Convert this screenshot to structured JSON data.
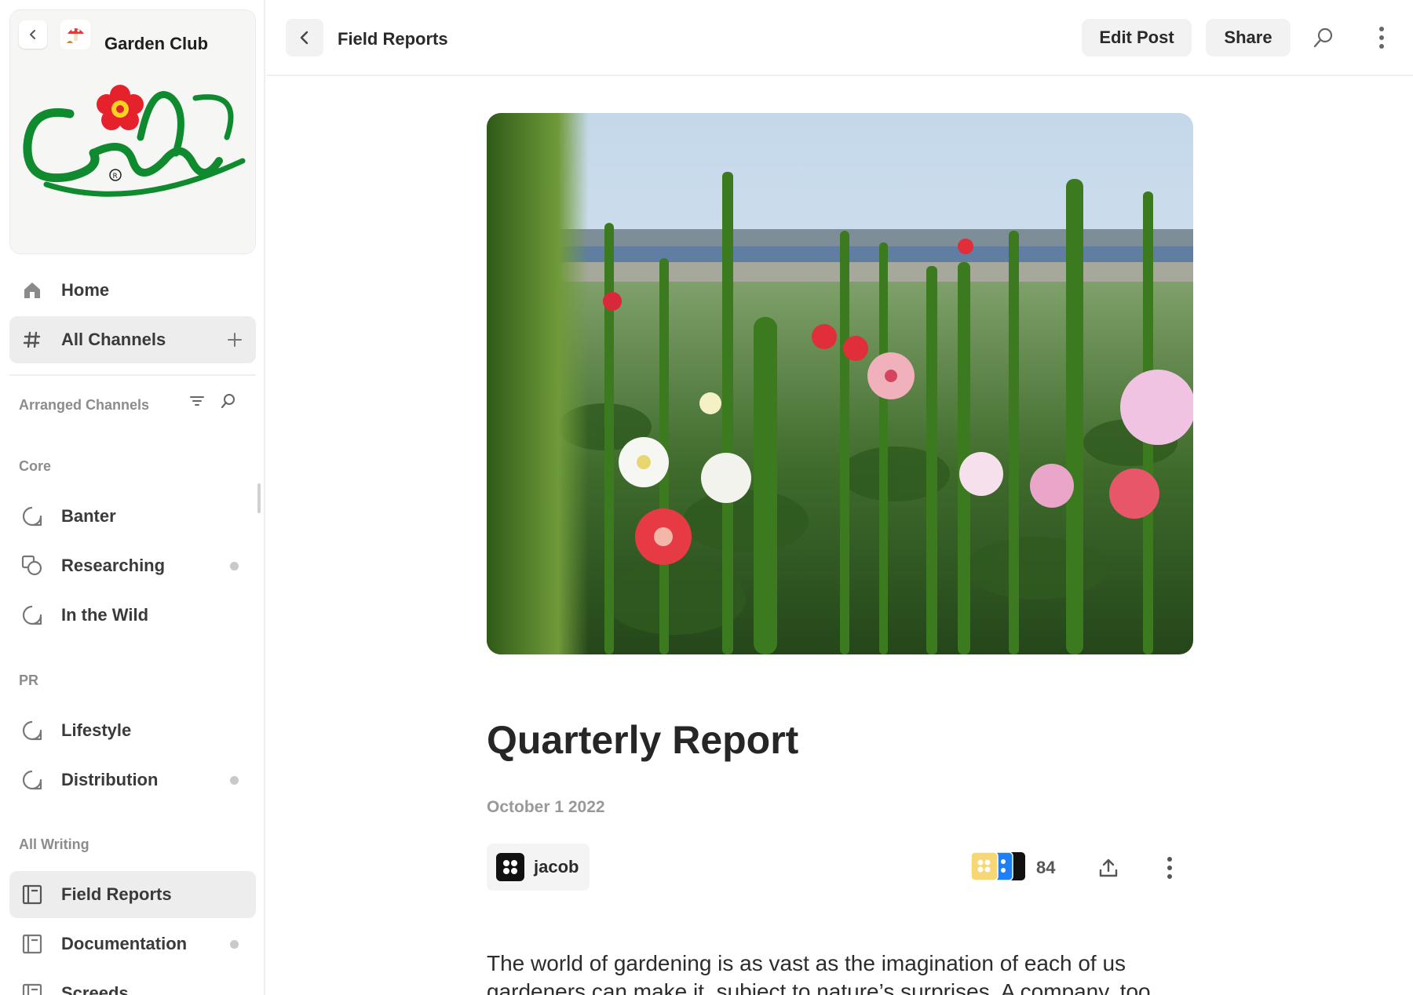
{
  "group": {
    "title": "Garden Club",
    "logo_text": "Garden"
  },
  "sidebar": {
    "nav": [
      {
        "label": "Home",
        "icon": "home-icon"
      },
      {
        "label": "All Channels",
        "icon": "hash-icon",
        "action_icon": "plus-icon"
      }
    ],
    "arranged_label": "Arranged Channels",
    "sections": [
      {
        "label": "Core",
        "channels": [
          {
            "label": "Banter",
            "icon": "chat-icon",
            "unread": false
          },
          {
            "label": "Researching",
            "icon": "gallery-icon",
            "unread": true
          },
          {
            "label": "In the Wild",
            "icon": "chat-icon",
            "unread": false
          }
        ]
      },
      {
        "label": "PR",
        "channels": [
          {
            "label": "Lifestyle",
            "icon": "chat-icon",
            "unread": false
          },
          {
            "label": "Distribution",
            "icon": "chat-icon",
            "unread": true
          }
        ]
      },
      {
        "label": "All Writing",
        "channels": [
          {
            "label": "Field Reports",
            "icon": "notebook-icon",
            "unread": false,
            "active": true
          },
          {
            "label": "Documentation",
            "icon": "notebook-icon",
            "unread": true
          },
          {
            "label": "Screeds",
            "icon": "notebook-icon",
            "unread": false
          }
        ]
      }
    ]
  },
  "header": {
    "title": "Field Reports",
    "edit_label": "Edit Post",
    "share_label": "Share"
  },
  "post": {
    "title": "Quarterly Report",
    "date": "October 1 2022",
    "author": "jacob",
    "reaction_count": "84",
    "body": "The world of gardening is as vast as the imagination of each of us gardeners can make it, subject to nature’s surprises. A company, too"
  },
  "colors": {
    "accent_yellow": "#f7d774",
    "accent_blue": "#1f7ff5",
    "logo_green": "#0f8a2e",
    "logo_red": "#e5212c"
  }
}
